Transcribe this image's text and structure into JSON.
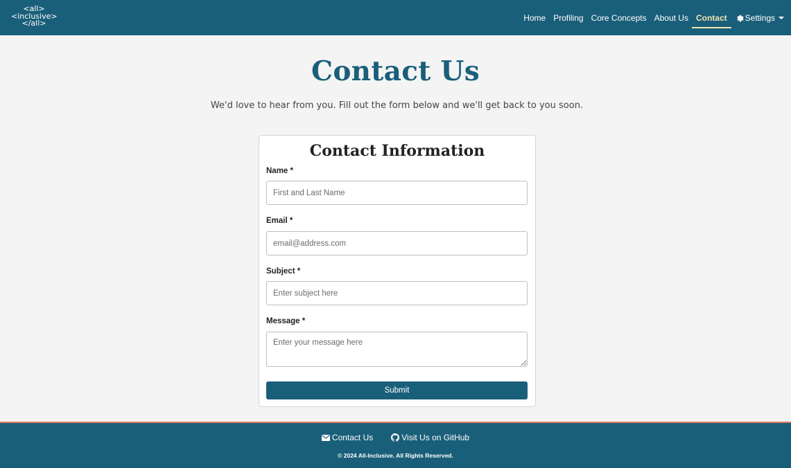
{
  "nav": {
    "logo_lines": [
      "<all>",
      "<inclusive>",
      "</all>"
    ],
    "links": [
      "Home",
      "Profiling",
      "Core Concepts",
      "About Us",
      "Contact"
    ],
    "active": "Contact",
    "settings_label": "Settings",
    "settings_icon": "gear-icon"
  },
  "header": {
    "title": "Contact Us",
    "intro": "We'd love to hear from you. Fill out the form below and we'll get back to you soon."
  },
  "form": {
    "title": "Contact Information",
    "name_label": "Name *",
    "name_placeholder": "First and Last Name",
    "email_label": "Email *",
    "email_placeholder": "email@address.com",
    "subject_label": "Subject *",
    "subject_placeholder": "Enter subject here",
    "message_label": "Message *",
    "message_placeholder": "Enter your message here",
    "submit_label": "Submit"
  },
  "footer": {
    "contact_label": "Contact Us",
    "contact_icon": "envelope-icon",
    "github_label": "Visit Us on GitHub",
    "github_icon": "github-icon",
    "copyright": "© 2024 All-Inclusive. All Rights Reserved."
  },
  "colors": {
    "primary": "#1a5f7a",
    "active_nav": "#f2e3b3",
    "footer_accent": "#e07a5f",
    "background": "#f4f4f4"
  }
}
